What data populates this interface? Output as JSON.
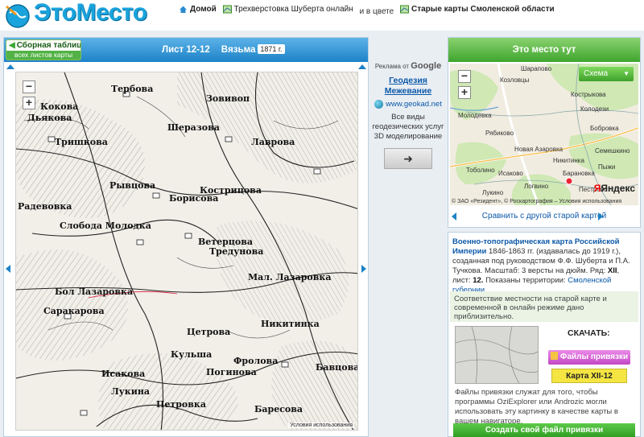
{
  "header": {
    "logo_text": "ЭтоМесто",
    "nav": {
      "home": "Домой",
      "schubert": "Трехверстовка Шуберта онлайн",
      "in_color": "и в цвете",
      "old_maps": "Старые карты Смоленской области"
    }
  },
  "left": {
    "summary_line1": "Сборная таблица",
    "summary_line2": "всех листов карты",
    "sheet": "Лист 12-12",
    "place": "Вязьма",
    "year": "1871 г.",
    "copyright": "Условия использования",
    "labels": [
      "Тербова",
      "Зовивоп",
      "Дьякова",
      "Кокова",
      "Шеразова",
      "Тришкова",
      "Лаврова",
      "Рывцова",
      "Борисова",
      "Кострицова",
      "Радевовка",
      "Слобода Молодка",
      "Ветерцова",
      "Тредунова",
      "Бол Лазаровка",
      "Мал. Лазаровка",
      "Саракарова",
      "Никитинка",
      "Цетрова",
      "Кульша",
      "Фролова",
      "Погинова",
      "Исакова",
      "Лукина",
      "Петровка",
      "Бавцова",
      "Баресова"
    ]
  },
  "ad": {
    "label": "Реклама от",
    "brand": "Google",
    "title": "Геодезия Межевание",
    "url": "www.geokad.net",
    "desc": "Все виды геодезических услуг 3D моделирование"
  },
  "right": {
    "title": "Это место тут",
    "scheme": "Схема",
    "yandex": "Яндекс",
    "map_copyright": "© ЗАО «Резидент», © Роскартография – Условия использования",
    "villages": [
      "Шарапово",
      "Козловцы",
      "Кострыкова",
      "Колодези",
      "Молодевка",
      "Рябиково",
      "Бобровка",
      "Новая Азаровка",
      "Никитинка",
      "Семешкино",
      "Исаково",
      "Барановка",
      "Тоболино",
      "Пыжи",
      "Логвино",
      "Лукино",
      "Пестрово"
    ],
    "compare": "Сравнить с другой старой картой",
    "desc_title": "Военно-топографическая карта Российской Империи",
    "desc_body": "1846-1863 гг. (издавалась до 1919 г.), созданная под руководством Ф.Ф. Шуберта и П.А. Тучкова. Масштаб: 3 версты на дюйм. Ряд:",
    "desc_row": "XII",
    "desc_sheet_label": ", лист:",
    "desc_sheet": "12.",
    "desc_terr": "Показаны территории:",
    "desc_region": "Смоленской губернии",
    "note": "Соответствие местности на старой карте и современной в онлайн режиме дано приблизительно.",
    "download": "СКАЧАТЬ:",
    "bind_files": "Файлы привязки",
    "map_btn": "Карта XII-12",
    "foot": "Файлы привязки служат для того, чтобы программы OziExplorer или Androzic могли использовать эту картинку в качестве карты в вашем навигаторе.",
    "create": "Создать свой файл привязки"
  },
  "colors": {
    "accent_blue": "#1d82c7",
    "accent_green": "#3fa52e",
    "logo": "#1aa3dc"
  }
}
